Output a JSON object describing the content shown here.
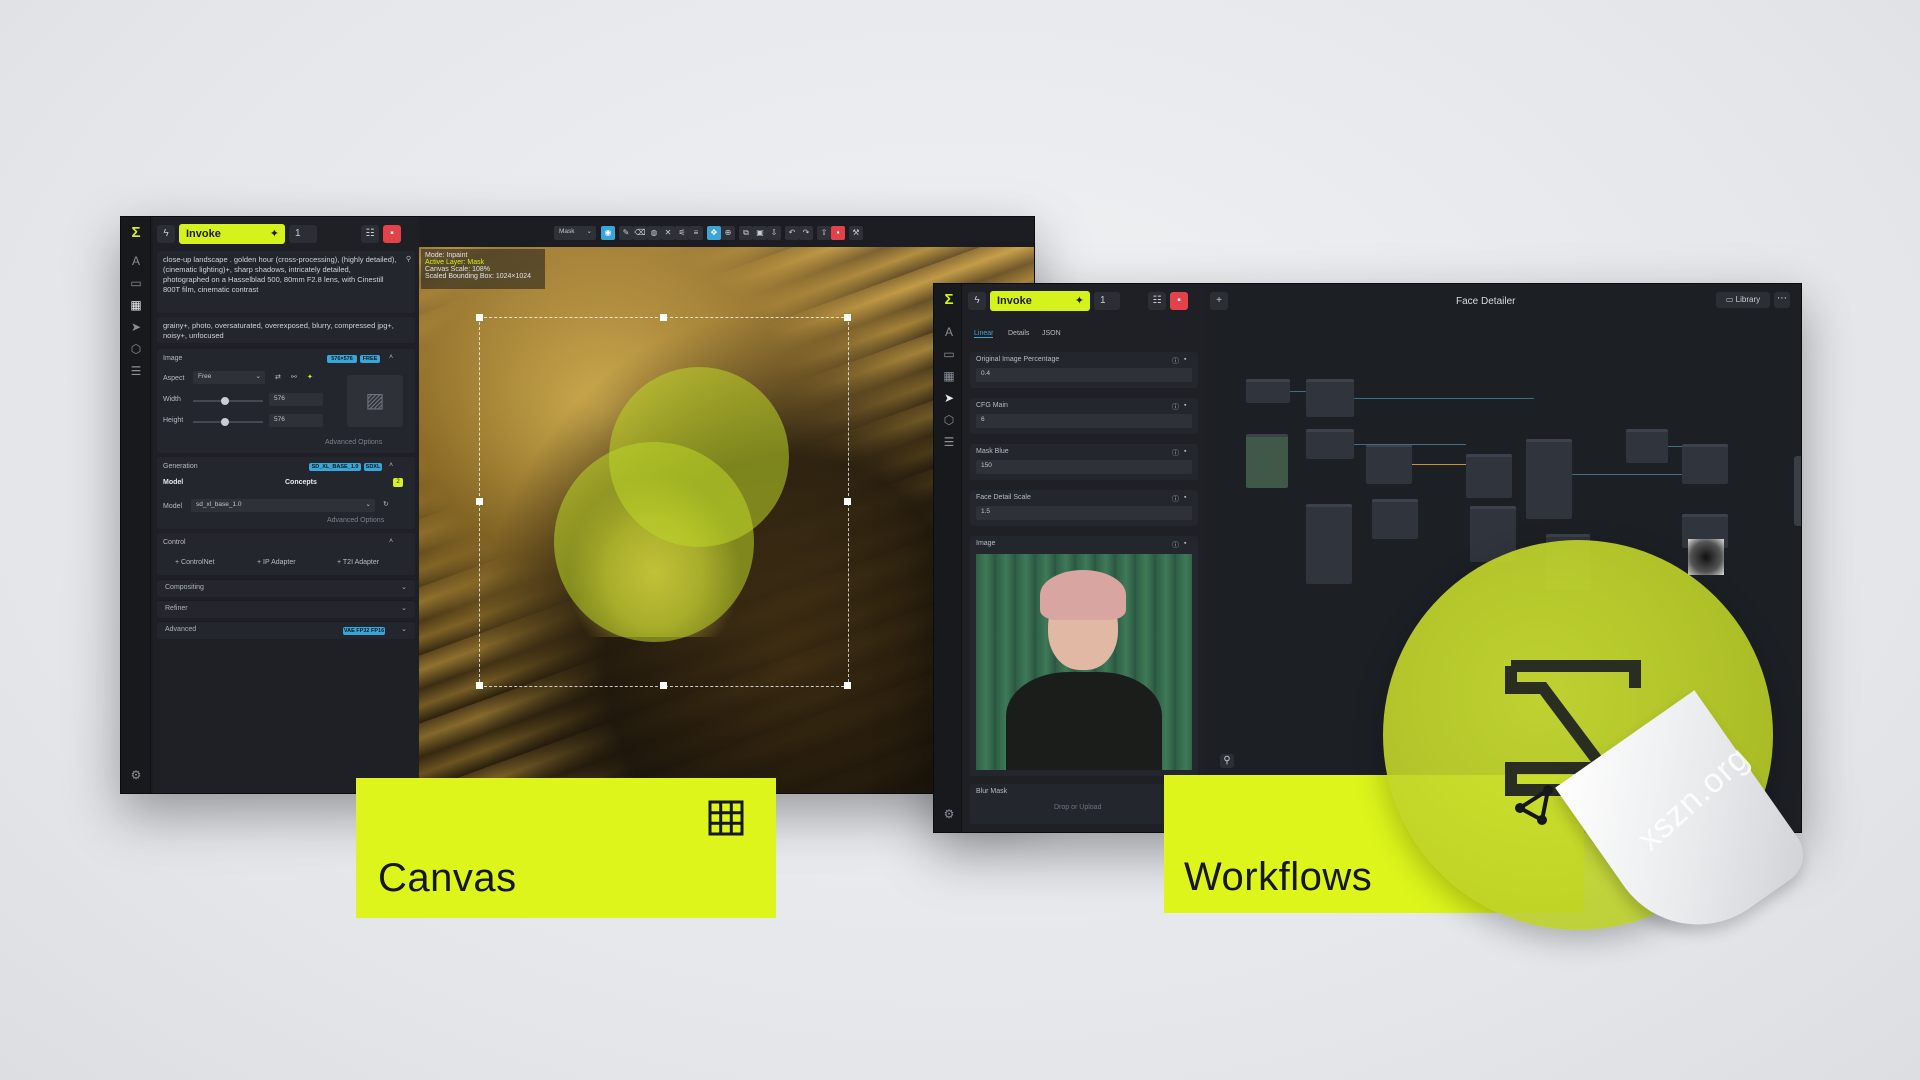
{
  "canvas_window": {
    "invoke_label": "Invoke",
    "queue_count": "1",
    "prompt_positive": "close-up landscape . golden hour  (cross-processing), (highly detailed), (cinematic lighting)+, sharp shadows, intricately detailed, photographed on a Hasselblad 500, 80mm F2.8 lens, with Cinestill 800T film, cinematic contrast",
    "prompt_negative": "grainy+, photo, oversaturated, overexposed, blurry, compressed jpg+, noisy+, unfocused",
    "image_section": {
      "title": "Image",
      "badge_size": "576×576",
      "badge_free": "FREE",
      "aspect_label": "Aspect",
      "aspect_value": "Free",
      "width_label": "Width",
      "width_value": "576",
      "height_label": "Height",
      "height_value": "576",
      "advanced_options": "Advanced Options"
    },
    "generation_section": {
      "title": "Generation",
      "badge_model": "SD_XL_BASE_1.0",
      "badge_type": "SDXL",
      "tab_model": "Model",
      "tab_concepts": "Concepts",
      "model_label": "Model",
      "model_value": "sd_xl_base_1.0",
      "advanced_options": "Advanced Options"
    },
    "control_section": {
      "title": "Control",
      "controlnet": "+ ControlNet",
      "ip_adapter": "+ IP Adapter",
      "t2i_adapter": "+ T2I Adapter"
    },
    "compositing": "Compositing",
    "refiner": "Refiner",
    "advanced": "Advanced",
    "advanced_badge": "VAE FP32 FP16",
    "canvas_toolbar": {
      "mode_select": "Mask"
    },
    "canvas_info": {
      "mode": "Mode: Inpaint",
      "layer": "Active Layer: Mask",
      "scale": "Canvas Scale: 108%",
      "bbox": "Scaled Bounding Box: 1024×1024"
    }
  },
  "workflows_window": {
    "invoke_label": "Invoke",
    "queue_count": "1",
    "title": "Face Detailer",
    "library_button": "Library",
    "tabs": [
      "Linear",
      "Details",
      "JSON"
    ],
    "fields": [
      {
        "label": "Original Image Percentage",
        "value": "0.4"
      },
      {
        "label": "CFG Main",
        "value": "6"
      },
      {
        "label": "Mask Blue",
        "value": "150"
      },
      {
        "label": "Face Detail Scale",
        "value": "1.5"
      }
    ],
    "image_label": "Image",
    "blur_mask_label": "Blur Mask",
    "drop_upload": "Drop or Upload"
  },
  "labels": {
    "canvas": "Canvas",
    "workflows": "Workflows"
  },
  "watermark": "xszn.org",
  "colors": {
    "accent": "#d6f21c",
    "danger": "#e2434a",
    "info": "#3aa6d8",
    "panel_bg": "#1b1d22"
  },
  "icons": {
    "canvas_card": "grid-icon",
    "workflows_card": "workflow-node-icon"
  }
}
